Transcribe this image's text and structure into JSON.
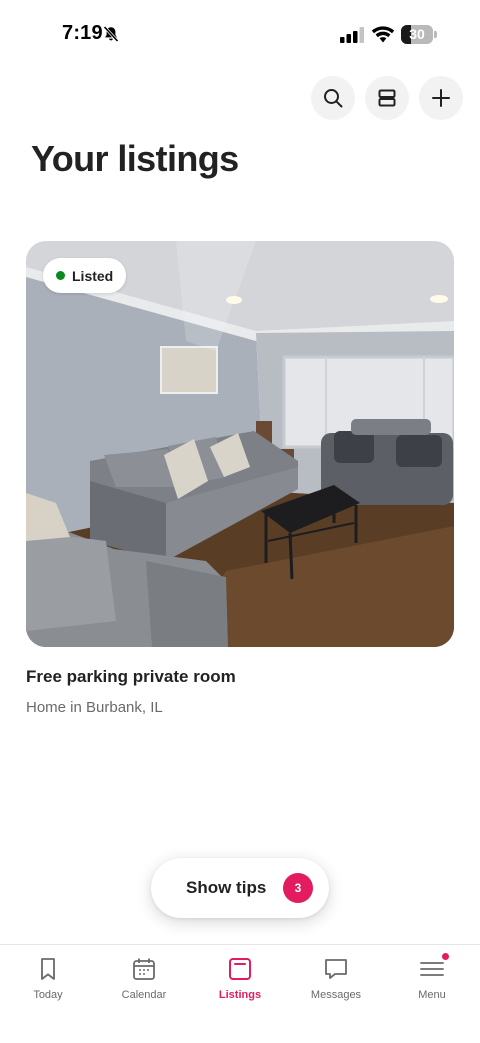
{
  "status_bar": {
    "time": "7:19",
    "battery_level": "30",
    "battery_fraction": 0.3,
    "icons": [
      "bell-slash-icon",
      "cellular-signal-icon",
      "wifi-icon",
      "battery-icon"
    ]
  },
  "header": {
    "title": "Your listings",
    "actions": [
      {
        "name": "search-button",
        "icon": "search-icon"
      },
      {
        "name": "view-toggle-button",
        "icon": "layout-rows-icon"
      },
      {
        "name": "add-listing-button",
        "icon": "plus-icon"
      }
    ]
  },
  "listing": {
    "status": "Listed",
    "status_color": "#0a8a1e",
    "title": "Free parking private room",
    "subtitle": "Home in Burbank, IL",
    "photo": "living-room-photo"
  },
  "tips": {
    "label": "Show tips",
    "count": "3",
    "badge_color": "#e31c5f"
  },
  "tabs": [
    {
      "label": "Today",
      "icon": "bookmark-icon",
      "active": false
    },
    {
      "label": "Calendar",
      "icon": "calendar-icon",
      "active": false
    },
    {
      "label": "Listings",
      "icon": "listings-icon",
      "active": true
    },
    {
      "label": "Messages",
      "icon": "message-bubble-icon",
      "active": false
    },
    {
      "label": "Menu",
      "icon": "menu-icon",
      "active": false,
      "has_notification": true
    }
  ],
  "colors": {
    "accent": "#e31c5f",
    "text": "#222222",
    "secondary_text": "#6a6a6a"
  }
}
